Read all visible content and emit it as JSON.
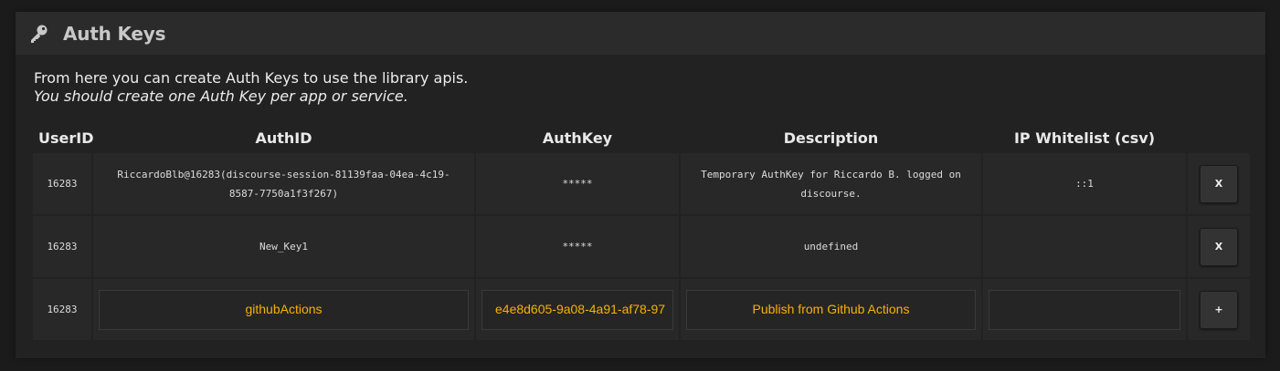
{
  "panel": {
    "title": "Auth Keys",
    "intro_line1": "From here you can create Auth Keys to use the library apis.",
    "intro_line2": "You should create one Auth Key per app or service."
  },
  "columns": [
    "UserID",
    "AuthID",
    "AuthKey",
    "Description",
    "IP Whitelist (csv)"
  ],
  "rows": [
    {
      "user_id": "16283",
      "auth_id": "RiccardoBlb@16283(discourse-session-81139faa-04ea-4c19-8587-7750a1f3f267)",
      "auth_key": "*****",
      "description": "Temporary AuthKey for Riccardo B. logged on discourse.",
      "ip_whitelist": "::1",
      "action": "X"
    },
    {
      "user_id": "16283",
      "auth_id": "New_Key1",
      "auth_key": "*****",
      "description": "undefined",
      "ip_whitelist": "",
      "action": "X"
    }
  ],
  "new_row": {
    "user_id": "16283",
    "auth_id_value": "githubActions",
    "auth_key_value": "e4e8d605-9a08-4a91-af78-97",
    "description_value": "Publish from Github Actions",
    "ip_whitelist_value": "",
    "action": "+"
  },
  "colors": {
    "accent": "#f5b300",
    "panel": "#222222",
    "header": "#2b2b2b",
    "cell": "#282828"
  },
  "icons": {
    "header": "key-icon"
  }
}
